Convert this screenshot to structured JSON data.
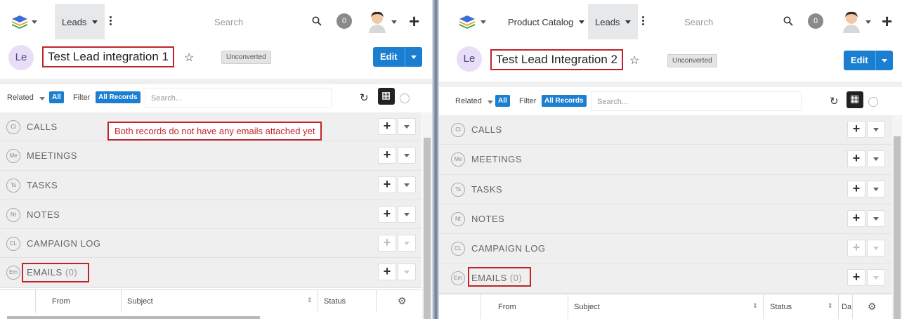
{
  "left": {
    "nav": {
      "tabs": [
        {
          "label": "Leads"
        }
      ],
      "search_placeholder": "Search",
      "notifications": "0"
    },
    "record": {
      "avatar": "Le",
      "title": "Test Lead integration 1",
      "status": "Unconverted",
      "edit_label": "Edit"
    },
    "filter": {
      "related": "Related",
      "all": "All",
      "filter": "Filter",
      "all_records": "All Records",
      "search_placeholder": "Search..."
    },
    "annotation": "Both records do not have any emails attached yet",
    "subpanels": [
      {
        "abbr": "Cl",
        "title": "CALLS"
      },
      {
        "abbr": "Me",
        "title": "MEETINGS"
      },
      {
        "abbr": "Ts",
        "title": "TASKS"
      },
      {
        "abbr": "Nt",
        "title": "NOTES"
      },
      {
        "abbr": "CL",
        "title": "CAMPAIGN LOG"
      },
      {
        "abbr": "Em",
        "title": "EMAILS",
        "count": "(0)"
      }
    ],
    "table": {
      "columns": [
        "From",
        "Subject",
        "Status"
      ]
    }
  },
  "right": {
    "nav": {
      "tabs": [
        {
          "label": "Product Catalog"
        },
        {
          "label": "Leads"
        }
      ],
      "search_placeholder": "Search",
      "notifications": "0"
    },
    "record": {
      "avatar": "Le",
      "title": "Test Lead Integration 2",
      "status": "Unconverted",
      "edit_label": "Edit"
    },
    "filter": {
      "related": "Related",
      "all": "All",
      "filter": "Filter",
      "all_records": "All Records",
      "search_placeholder": "Search..."
    },
    "subpanels": [
      {
        "abbr": "Cl",
        "title": "CALLS"
      },
      {
        "abbr": "Me",
        "title": "MEETINGS"
      },
      {
        "abbr": "Ts",
        "title": "TASKS"
      },
      {
        "abbr": "Nt",
        "title": "NOTES"
      },
      {
        "abbr": "CL",
        "title": "CAMPAIGN LOG"
      },
      {
        "abbr": "Em",
        "title": "EMAILS",
        "count": "(0)"
      }
    ],
    "table": {
      "columns": [
        "From",
        "Subject",
        "Status",
        "Da"
      ]
    }
  },
  "colors": {
    "accent": "#1a7fd1",
    "highlight": "#c0252a",
    "panel_bg": "#efefef"
  },
  "icons": [
    "stack-logo-icon",
    "kebab-icon",
    "search-icon",
    "user-avatar-icon",
    "plus-icon",
    "star-icon",
    "refresh-icon",
    "grid-icon",
    "clock-icon",
    "gear-icon",
    "sort-icon"
  ]
}
